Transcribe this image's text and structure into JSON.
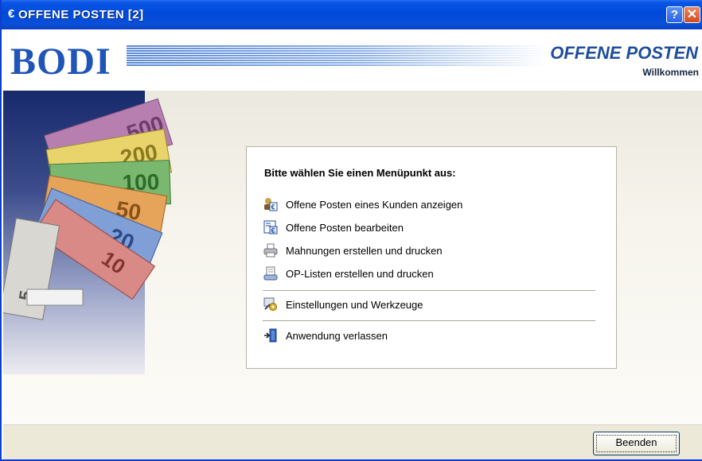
{
  "window": {
    "euro_symbol": "€",
    "title": "OFFENE POSTEN [2]",
    "help_label": "?",
    "close_label": "✕"
  },
  "header": {
    "logo": "BODI",
    "title": "OFFENE POSTEN",
    "subtitle": "Willkommen"
  },
  "banner": {
    "note_values": [
      "500",
      "200",
      "100",
      "50",
      "20",
      "10",
      "5"
    ]
  },
  "menu": {
    "prompt": "Bitte wählen Sie einen Menüpunkt aus:",
    "items": [
      {
        "label": "Offene Posten eines Kunden anzeigen",
        "icon": "customer-euro-icon"
      },
      {
        "label": "Offene Posten bearbeiten",
        "icon": "edit-euro-icon"
      },
      {
        "label": "Mahnungen erstellen und drucken",
        "icon": "printer-icon"
      },
      {
        "label": "OP-Listen erstellen und drucken",
        "icon": "document-print-icon"
      },
      {
        "label": "Einstellungen und Werkzeuge",
        "icon": "settings-tools-icon"
      },
      {
        "label": "Anwendung verlassen",
        "icon": "exit-door-icon"
      }
    ]
  },
  "footer": {
    "exit_button": "Beenden"
  }
}
